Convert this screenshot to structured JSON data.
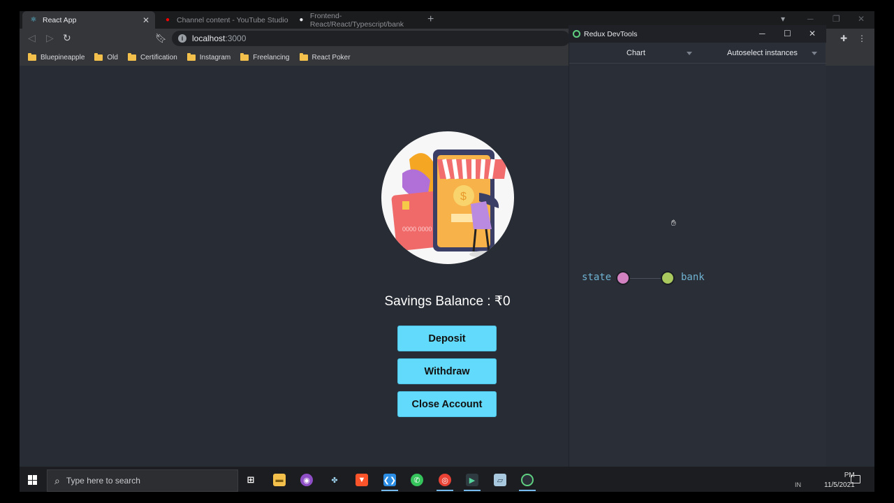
{
  "browser": {
    "tabs": [
      {
        "label": "React App",
        "active": true
      },
      {
        "label": "Channel content - YouTube Studio",
        "active": false
      },
      {
        "label": "Frontend-React/React/Typescript/bank",
        "active": false
      }
    ],
    "url": {
      "host": "localhost",
      "port": ":3000"
    },
    "bookmarks": [
      "Bluepineapple",
      "Old",
      "Certification",
      "Instagram",
      "Freelancing",
      "React Poker"
    ]
  },
  "app": {
    "balance_text": "Savings Balance : ₹0",
    "buttons": {
      "deposit": "Deposit",
      "withdraw": "Withdraw",
      "close": "Close Account"
    },
    "illustration_text": "0000 0000"
  },
  "devtools": {
    "title": "Redux DevTools",
    "monitor": "Chart",
    "instances": "Autoselect instances",
    "tree": {
      "root": "state",
      "child": "bank"
    },
    "colors": {
      "root_node": "#d282c0",
      "child_node": "#a9c95e",
      "label": "#6fb3d2"
    }
  },
  "taskbar": {
    "search_placeholder": "Type here to search",
    "time": "PM",
    "date": "11/5/2021",
    "lang": "IN"
  }
}
